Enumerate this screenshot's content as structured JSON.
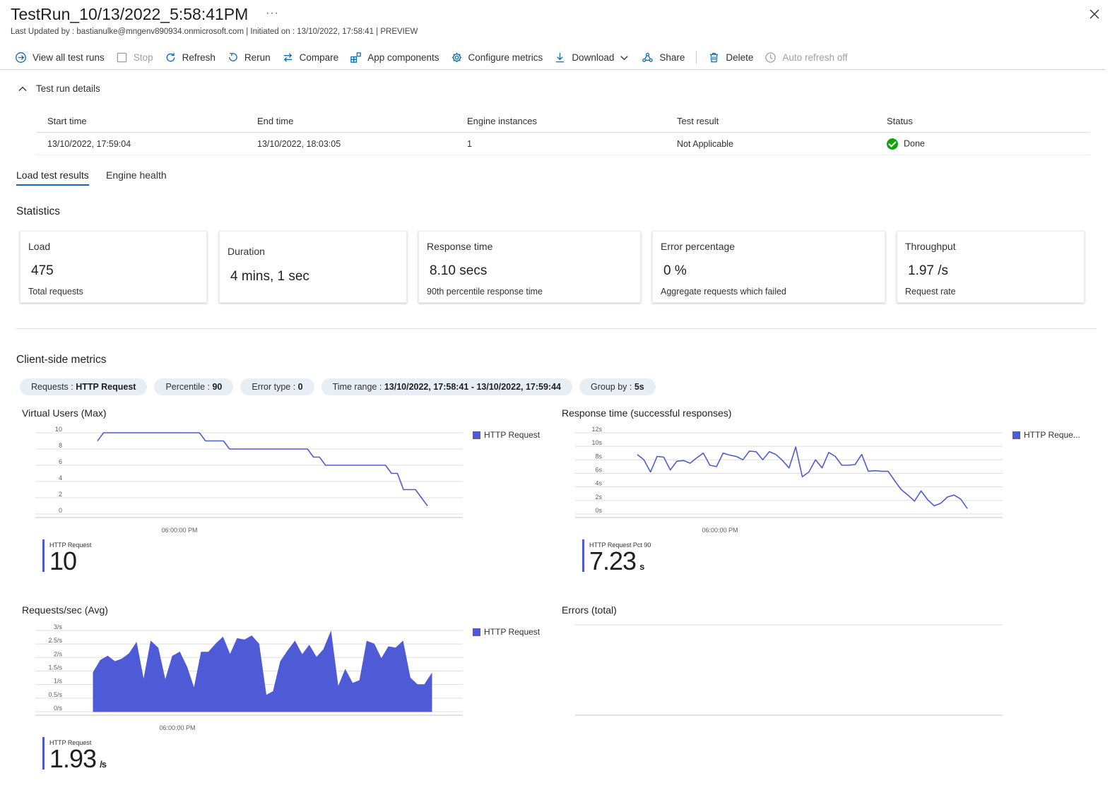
{
  "header": {
    "title": "TestRun_10/13/2022_5:58:41PM",
    "more": "···",
    "subtitle": "Last Updated by : bastianulke@mngenv890934.onmicrosoft.com | Initiated on : 13/10/2022, 17:58:41 | PREVIEW"
  },
  "toolbar": {
    "view_all": "View all test runs",
    "stop": "Stop",
    "refresh": "Refresh",
    "rerun": "Rerun",
    "compare": "Compare",
    "app_components": "App components",
    "configure_metrics": "Configure metrics",
    "download": "Download",
    "share": "Share",
    "delete": "Delete",
    "auto_refresh": "Auto refresh off"
  },
  "details": {
    "toggle_label": "Test run details",
    "headers": [
      "Start time",
      "End time",
      "Engine instances",
      "Test result",
      "Status"
    ],
    "values": [
      "13/10/2022, 17:59:04",
      "13/10/2022, 18:03:05",
      "1",
      "Not Applicable",
      "Done"
    ]
  },
  "tabs": [
    "Load test results",
    "Engine health"
  ],
  "statistics": {
    "heading": "Statistics",
    "cards": [
      {
        "label": "Load",
        "value": "475",
        "sub": "Total requests"
      },
      {
        "label": "Duration",
        "value": "4 mins, 1 sec",
        "sub": ""
      },
      {
        "label": "Response time",
        "value": "8.10 secs",
        "sub": "90th percentile response time"
      },
      {
        "label": "Error percentage",
        "value": "0 %",
        "sub": "Aggregate requests which failed"
      },
      {
        "label": "Throughput",
        "value": "1.97 /s",
        "sub": "Request rate"
      }
    ]
  },
  "metrics": {
    "heading": "Client-side metrics",
    "filters": [
      {
        "key": "Requests",
        "value": "HTTP Request"
      },
      {
        "key": "Percentile",
        "value": "90"
      },
      {
        "key": "Error type",
        "value": "0"
      },
      {
        "key": "Time range",
        "value": "13/10/2022, 17:58:41 - 13/10/2022, 17:59:44"
      },
      {
        "key": "Group by",
        "value": "5s"
      }
    ]
  },
  "colors": {
    "accent": "#0f6cbd",
    "series": "#4f5ad6",
    "success": "#13a10e"
  },
  "charts": {
    "vu": {
      "title": "Virtual Users (Max)",
      "legend": "HTTP Request",
      "summary_label": "HTTP Request",
      "summary_value": "10",
      "summary_unit": ""
    },
    "rt": {
      "title": "Response time (successful responses)",
      "legend": "HTTP Reque...",
      "summary_label": "HTTP Request Pct 90",
      "summary_value": "7.23",
      "summary_unit": "s"
    },
    "rps": {
      "title": "Requests/sec (Avg)",
      "legend": "HTTP Request",
      "summary_label": "HTTP Request",
      "summary_value": "1.93",
      "summary_unit": "/s"
    },
    "err": {
      "title": "Errors (total)"
    }
  },
  "chart_data": [
    {
      "type": "line",
      "title": "Virtual Users (Max)",
      "x_tick_label": "06:00:00 PM",
      "ylim": [
        0,
        10
      ],
      "y_ticks": [
        "0",
        "2",
        "4",
        "6",
        "8",
        "10"
      ],
      "series": [
        {
          "name": "HTTP Request",
          "values": [
            9,
            10,
            10,
            10,
            10,
            10,
            10,
            10,
            10,
            10,
            10,
            10,
            10,
            10,
            10,
            10,
            10,
            10,
            9,
            9,
            9,
            9,
            8,
            8,
            8,
            8,
            8,
            8,
            8,
            8,
            8,
            8,
            8,
            8,
            8,
            8,
            7,
            7,
            6,
            6,
            6,
            6,
            6,
            6,
            6,
            6,
            6,
            6,
            6,
            5,
            5,
            3,
            3,
            3,
            2,
            1
          ]
        }
      ]
    },
    {
      "type": "line",
      "title": "Response time (successful responses)",
      "x_tick_label": "06:00:00 PM",
      "ylim": [
        0,
        12
      ],
      "y_ticks": [
        "0s",
        "2s",
        "4s",
        "6s",
        "8s",
        "10s",
        "12s"
      ],
      "series": [
        {
          "name": "HTTP Request Pct 90",
          "values": [
            8.8,
            8.0,
            6.2,
            8.5,
            8.4,
            6.5,
            7.8,
            7.9,
            7.5,
            8.3,
            9.0,
            7.2,
            7.0,
            9.0,
            8.7,
            8.5,
            8.0,
            9.3,
            9.2,
            8.0,
            9.2,
            8.8,
            7.9,
            6.8,
            9.9,
            5.5,
            6.2,
            8.0,
            6.8,
            9.1,
            8.5,
            7.2,
            7.2,
            7.3,
            8.8,
            6.3,
            6.4,
            6.3,
            6.3,
            4.9,
            3.6,
            2.8,
            1.9,
            3.4,
            2.1,
            1.2,
            1.6,
            2.5,
            2.8,
            2.2,
            0.8
          ]
        }
      ]
    },
    {
      "type": "area",
      "title": "Requests/sec (Avg)",
      "x_tick_label": "06:00:00 PM",
      "ylim": [
        0,
        3
      ],
      "y_ticks": [
        "0/s",
        "0.5/s",
        "1/s",
        "1.5/s",
        "2/s",
        "2.5/s",
        "3/s"
      ],
      "series": [
        {
          "name": "HTTP Request",
          "values": [
            1.45,
            1.9,
            2.05,
            1.85,
            1.95,
            2.15,
            2.55,
            1.15,
            2.6,
            2.35,
            1.15,
            2.05,
            2.2,
            1.65,
            0.85,
            2.2,
            2.2,
            2.5,
            2.75,
            2.1,
            2.7,
            2.65,
            2.8,
            2.5,
            0.6,
            0.75,
            1.85,
            2.25,
            2.6,
            2.1,
            2.45,
            2.0,
            2.3,
            2.95,
            0.9,
            1.55,
            1.05,
            1.15,
            2.6,
            2.5,
            1.95,
            2.4,
            2.35,
            2.6,
            1.25,
            1.0,
            1.0,
            1.4
          ]
        }
      ]
    },
    {
      "type": "line",
      "title": "Errors (total)",
      "series": []
    }
  ]
}
